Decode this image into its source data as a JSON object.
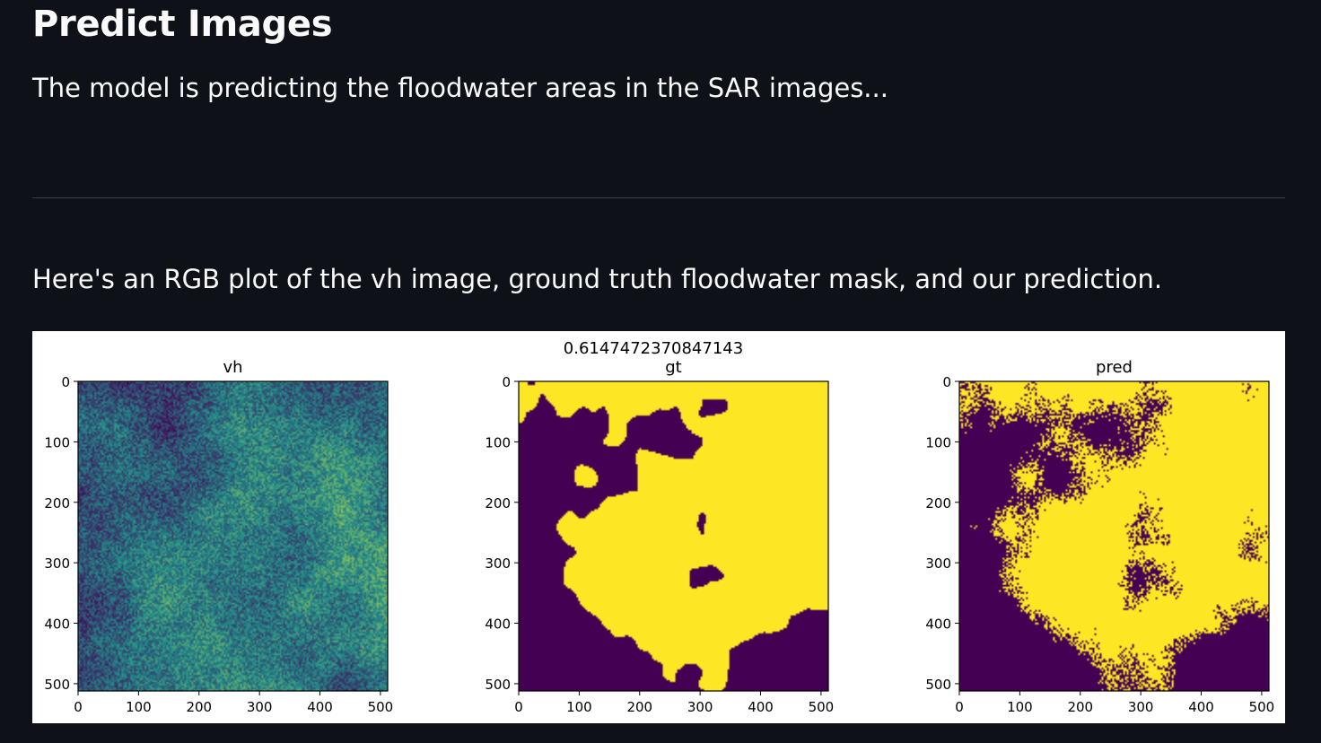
{
  "page": {
    "title": "Predict Images",
    "intro_text": "The model is predicting the floodwater areas in the SAR images...",
    "plot_caption": "Here's an RGB plot of the vh image, ground truth floodwater mask, and our prediction."
  },
  "figure": {
    "suptitle": "0.6147472370847143",
    "panels": [
      {
        "id": "vh",
        "title": "vh",
        "kind": "continuous"
      },
      {
        "id": "gt",
        "title": "gt",
        "kind": "binary"
      },
      {
        "id": "pred",
        "title": "pred",
        "kind": "binary"
      }
    ],
    "x_ticks": [
      "0",
      "100",
      "200",
      "300",
      "400",
      "500"
    ],
    "y_ticks": [
      "0",
      "100",
      "200",
      "300",
      "400",
      "500"
    ],
    "colormap": {
      "name": "viridis",
      "low": "#440154",
      "mid": "#21918c",
      "high": "#fde725"
    },
    "colors": {
      "background": "#0e1117",
      "text": "#fafafa",
      "divider": "#3b3e47",
      "figure_background": "#ffffff"
    }
  }
}
